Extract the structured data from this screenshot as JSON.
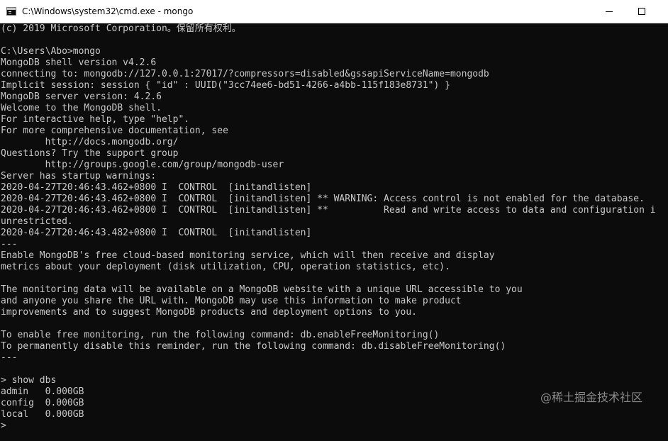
{
  "window": {
    "title": "C:\\Windows\\system32\\cmd.exe - mongo",
    "icon": "cmd-console-icon"
  },
  "console": {
    "lines": [
      "(c) 2019 Microsoft Corporation。保留所有权利。",
      "",
      "C:\\Users\\Abo>mongo",
      "MongoDB shell version v4.2.6",
      "connecting to: mongodb://127.0.0.1:27017/?compressors=disabled&gssapiServiceName=mongodb",
      "Implicit session: session { \"id\" : UUID(\"3cc74ee6-bd51-4266-a4bb-115f183e8731\") }",
      "MongoDB server version: 4.2.6",
      "Welcome to the MongoDB shell.",
      "For interactive help, type \"help\".",
      "For more comprehensive documentation, see",
      "        http://docs.mongodb.org/",
      "Questions? Try the support group",
      "        http://groups.google.com/group/mongodb-user",
      "Server has startup warnings:",
      "2020-04-27T20:46:43.462+0800 I  CONTROL  [initandlisten]",
      "2020-04-27T20:46:43.462+0800 I  CONTROL  [initandlisten] ** WARNING: Access control is not enabled for the database.",
      "2020-04-27T20:46:43.462+0800 I  CONTROL  [initandlisten] **          Read and write access to data and configuration i",
      "unrestricted.",
      "2020-04-27T20:46:43.482+0800 I  CONTROL  [initandlisten]",
      "---",
      "Enable MongoDB's free cloud-based monitoring service, which will then receive and display",
      "metrics about your deployment (disk utilization, CPU, operation statistics, etc).",
      "",
      "The monitoring data will be available on a MongoDB website with a unique URL accessible to you",
      "and anyone you share the URL with. MongoDB may use this information to make product",
      "improvements and to suggest MongoDB products and deployment options to you.",
      "",
      "To enable free monitoring, run the following command: db.enableFreeMonitoring()",
      "To permanently disable this reminder, run the following command: db.disableFreeMonitoring()",
      "---",
      "",
      "> show dbs",
      "admin   0.000GB",
      "config  0.000GB",
      "local   0.000GB",
      ">"
    ]
  },
  "watermark": "@稀土掘金技术社区",
  "colors": {
    "console_bg": "#0c0c0c",
    "console_text": "#c8c8c8",
    "titlebar_bg": "#ffffff"
  }
}
